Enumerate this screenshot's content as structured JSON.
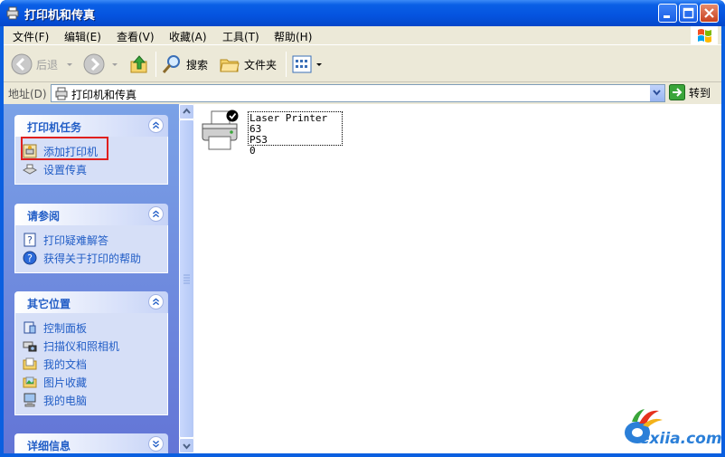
{
  "window": {
    "title": "打印机和传真"
  },
  "menu": [
    {
      "label": "文件(F)"
    },
    {
      "label": "编辑(E)"
    },
    {
      "label": "查看(V)"
    },
    {
      "label": "收藏(A)"
    },
    {
      "label": "工具(T)"
    },
    {
      "label": "帮助(H)"
    }
  ],
  "toolbar": {
    "back_label": "后退",
    "search_label": "搜索",
    "folders_label": "文件夹"
  },
  "address": {
    "label": "地址(D)",
    "value": "打印机和传真",
    "go_label": "转到"
  },
  "tasks": {
    "printer_tasks": {
      "title": "打印机任务",
      "items": [
        "添加打印机",
        "设置传真"
      ]
    },
    "see_also": {
      "title": "请参阅",
      "items": [
        "打印疑难解答",
        "获得关于打印的帮助"
      ]
    },
    "other_places": {
      "title": "其它位置",
      "items": [
        "控制面板",
        "扫描仪和照相机",
        "我的文档",
        "图片收藏",
        "我的电脑"
      ]
    },
    "details": {
      "title": "详细信息"
    }
  },
  "content": {
    "printer": {
      "label_line1": "Laser Printer 63",
      "label_line2": "PS3",
      "label_line3": "0"
    }
  },
  "watermark": {
    "text": "exiia.com"
  },
  "colors": {
    "title_blue": "#0553df",
    "task_link": "#215dc6",
    "pane_blue": "#6f8fe0",
    "highlight": "#e0201e"
  }
}
